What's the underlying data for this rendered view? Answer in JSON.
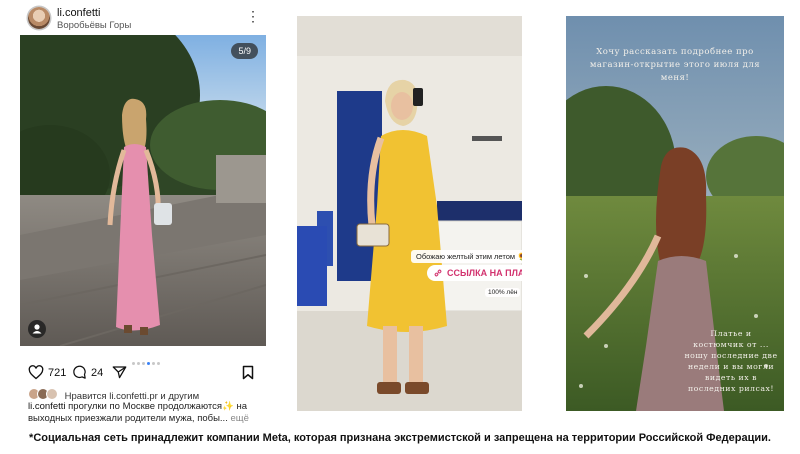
{
  "post": {
    "username": "li.confetti",
    "location": "Воробьёвы Горы",
    "menu_icon": "more-vertical-icon",
    "counter": "5/9",
    "likes_count": "721",
    "comments_count": "24",
    "liked_by_prefix": "Нравится ",
    "liked_by_user": "li.confetti.pr",
    "liked_by_suffix": " и другим",
    "caption_user": "li.confetti",
    "caption_text": " прогулки по Москве продолжаются✨ на выходных приезжали родители мужа, побы...",
    "caption_more": " ещё",
    "icons": [
      "heart-icon",
      "comment-icon",
      "share-icon",
      "bookmark-icon",
      "tagged-person-icon"
    ]
  },
  "story1": {
    "sticker_text": "Обожаю желтый этим летом 🌻",
    "link_label": "ССЫЛКА НА ПЛАТЬЕ",
    "badge_text": "100% лён"
  },
  "story2": {
    "top_text": "Хочу рассказать подробнее про магазин-открытие этого июля для меня!",
    "bottom_text": "Платье и костюмчик от ... ношу последние две недели и вы могли видеть их в последних рилсах!"
  },
  "footer": {
    "disclaimer": "*Социальная сеть принадлежит компании Meta, которая признана экстремистской и запрещена на территории Российской Федерации."
  },
  "colors": {
    "accent_link": "#d2326e",
    "dot_active": "#3b82f6",
    "dress_pink": "#e58fae",
    "dress_yellow": "#f1c232"
  }
}
